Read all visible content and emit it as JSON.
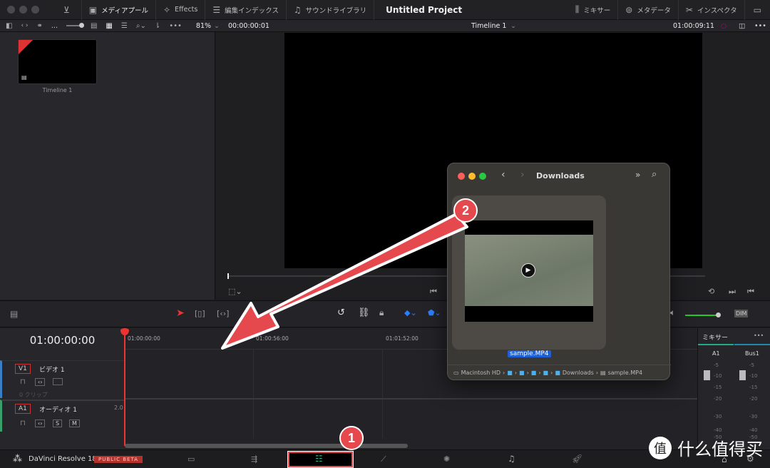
{
  "topbar": {
    "items": [
      "メディアプール",
      "Effects",
      "編集インデックス",
      "サウンドライブラリ"
    ],
    "title": "Untitled Project",
    "right_items": [
      "ミキサー",
      "メタデータ",
      "インスペクタ"
    ]
  },
  "toolbar2": {
    "more": "...",
    "zoom": "81%",
    "timecode_left": "00:00:00:01",
    "timeline_name": "Timeline 1",
    "timecode_right": "01:00:09:11"
  },
  "media_pool": {
    "clips": [
      {
        "label": "Timeline 1"
      }
    ]
  },
  "timeline": {
    "timecode": "01:00:00:00",
    "ruler": [
      "01:00:00:00",
      "01:00:56:00",
      "01:01:52:00"
    ],
    "dim_label": "DIM",
    "tracks": [
      {
        "id": "V1",
        "name": "ビデオ 1",
        "info": "0 クリップ"
      },
      {
        "id": "A1",
        "name": "オーディオ 1",
        "level": "2.0",
        "solo": "S",
        "mute": "M"
      }
    ]
  },
  "mixer": {
    "title": "ミキサー",
    "more": "•••",
    "channels": [
      "A1",
      "Bus1"
    ],
    "scale": [
      "-5",
      "-10",
      "-15",
      "-20",
      "-30",
      "-40",
      "-50"
    ]
  },
  "bottom": {
    "app_name": "DaVinci Resolve 18",
    "beta": "PUBLIC BETA"
  },
  "finder": {
    "title": "Downloads",
    "file": "sample.MP4",
    "path": [
      "Macintosh HD",
      "Downloads",
      "sample.MP4"
    ]
  },
  "annotations": {
    "badge1": "1",
    "badge2": "2",
    "accent": "#e5484d"
  },
  "watermark": {
    "text": "什么值得买",
    "logo": "值"
  }
}
